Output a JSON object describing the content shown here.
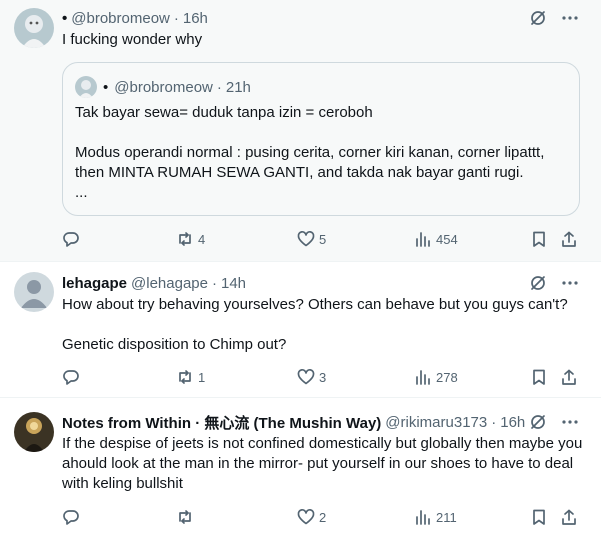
{
  "tweets": [
    {
      "name": "•",
      "handle": "@brobromeow",
      "time": "16h",
      "text": "I fucking wonder why",
      "quote": {
        "name": "•",
        "handle": "@brobromeow",
        "time": "21h",
        "text": "Tak bayar sewa= duduk tanpa izin = ceroboh\n\nModus operandi normal : pusing cerita, corner kiri kanan, corner lipattt, then MINTA RUMAH SEWA GANTI, and takda nak bayar ganti rugi.\n..."
      },
      "replies": "",
      "reposts": "4",
      "likes": "5",
      "views": "454"
    },
    {
      "name": "lehagape",
      "handle": "@lehagape",
      "time": "14h",
      "text": "How about try behaving yourselves? Others can behave but you guys can't?\n\nGenetic disposition to Chimp out?",
      "replies": "",
      "reposts": "1",
      "likes": "3",
      "views": "278"
    },
    {
      "name": "Notes from Within · 無心流 (The Mushin Way)",
      "handle": "@rikimaru3173",
      "time": "16h",
      "text": "If the despise of jeets is not confined domestically but globally then maybe you ahould look at the man in the mirror- put yourself in our shoes to have to deal with keling bullshit",
      "replies": "",
      "reposts": "",
      "likes": "2",
      "views": "211"
    }
  ],
  "separator": "·",
  "icons": [
    "grok-icon",
    "more-icon",
    "reply-icon",
    "repost-icon",
    "like-icon",
    "views-icon",
    "bookmark-icon",
    "share-icon"
  ],
  "colors": {
    "text": "#0f1419",
    "secondary": "#536471",
    "border": "#cfd9de",
    "highlight_bg": "#f7f9f9"
  }
}
